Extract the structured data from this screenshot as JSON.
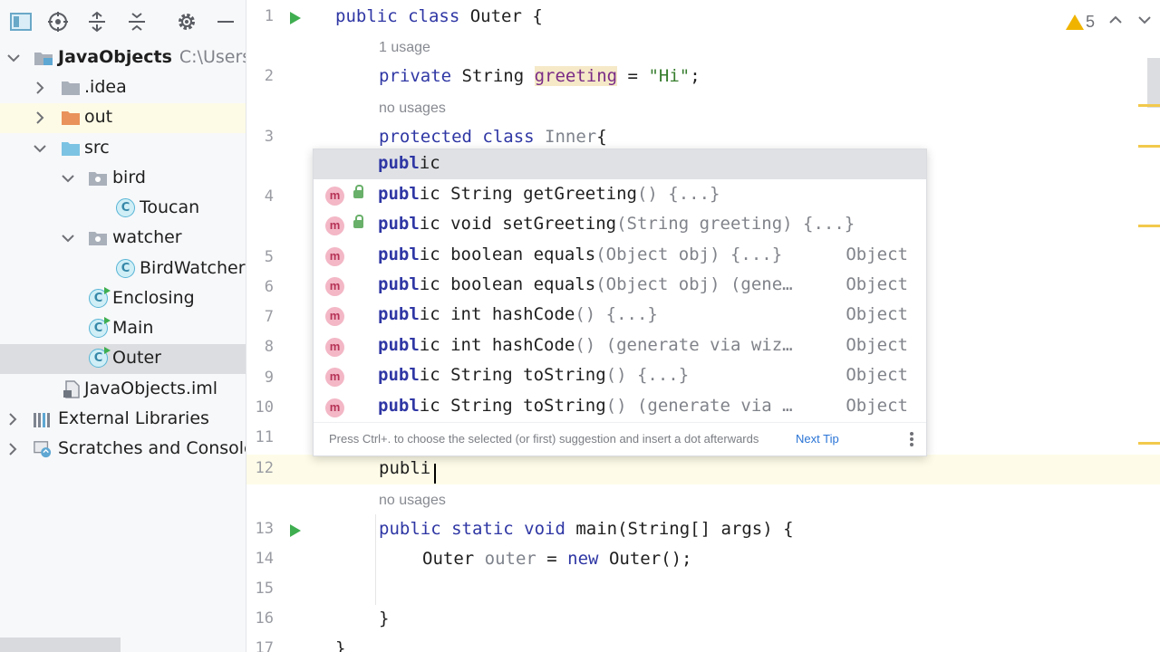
{
  "sidebar": {
    "toolbar": [
      {
        "icon": "project-view-icon"
      },
      {
        "icon": "locate-target-icon"
      },
      {
        "icon": "expand-all-icon"
      },
      {
        "icon": "collapse-all-icon"
      },
      {
        "icon": "gear-icon"
      },
      {
        "icon": "minimize-icon"
      }
    ],
    "tree": {
      "root_label": "JavaObjects",
      "root_path": "C:\\Users\\r",
      "idea": ".idea",
      "out": "out",
      "src": "src",
      "bird": "bird",
      "toucan": "Toucan",
      "watcher": "watcher",
      "birdwatcher": "BirdWatcher",
      "enclosing": "Enclosing",
      "main": "Main",
      "outer": "Outer",
      "iml": "JavaObjects.iml",
      "external_libraries": "External Libraries",
      "scratches": "Scratches and Consoles"
    },
    "class_badge": "C"
  },
  "editor": {
    "warnings_count": "5",
    "lines": {
      "l1": {
        "num": "1",
        "kw": "public class",
        "rest": " Outer {"
      },
      "h1": "1 usage",
      "l2": {
        "num": "2",
        "kw": "private",
        "type": " String ",
        "field": "greeting",
        "eq": " = ",
        "str": "\"Hi\"",
        "end": ";"
      },
      "h2": "no usages",
      "l3": {
        "num": "3",
        "kw": "protected class",
        "name": " Inner",
        "brace": "{"
      },
      "l4": {
        "num": "4"
      },
      "l5": {
        "num": "5"
      },
      "l6": {
        "num": "6"
      },
      "l7": {
        "num": "7"
      },
      "l8": {
        "num": "8"
      },
      "l9": {
        "num": "9"
      },
      "l10": {
        "num": "10"
      },
      "l11": {
        "num": "11"
      },
      "l12": {
        "num": "12",
        "typed": "publi"
      },
      "h3": "no usages",
      "l13": {
        "num": "13",
        "kw": "public static void",
        "rest": " main(String[] args) {"
      },
      "l14": {
        "num": "14",
        "type": "Outer ",
        "var": "outer",
        "eq": " = ",
        "kw": "new",
        "rest": " Outer();"
      },
      "l15": {
        "num": "15"
      },
      "l16": {
        "num": "16",
        "text": "}"
      },
      "l17": {
        "num": "17",
        "text": "}"
      }
    }
  },
  "completion": {
    "badge": "m",
    "items": [
      {
        "match": "publ",
        "rest": "ic",
        "tail": "",
        "type": ""
      },
      {
        "match": "publ",
        "rest": "ic String getGreeting",
        "tail": "() {...}",
        "type": ""
      },
      {
        "match": "publ",
        "rest": "ic void setGreeting",
        "tail": "(String greeting) {...}",
        "type": ""
      },
      {
        "match": "publ",
        "rest": "ic boolean equals",
        "tail": "(Object obj) {...}",
        "type": "Object"
      },
      {
        "match": "publ",
        "rest": "ic boolean equals",
        "tail": "(Object obj) (gene…",
        "type": "Object"
      },
      {
        "match": "publ",
        "rest": "ic int hashCode",
        "tail": "() {...}",
        "type": "Object"
      },
      {
        "match": "publ",
        "rest": "ic int hashCode",
        "tail": "() (generate via wiz…",
        "type": "Object"
      },
      {
        "match": "publ",
        "rest": "ic String toString",
        "tail": "() {...}",
        "type": "Object"
      },
      {
        "match": "publ",
        "rest": "ic String toString",
        "tail": "() (generate via …",
        "type": "Object"
      }
    ],
    "footer_hint": "Press Ctrl+. to choose the selected (or first) suggestion and insert a dot afterwards",
    "next_tip": "Next Tip"
  }
}
